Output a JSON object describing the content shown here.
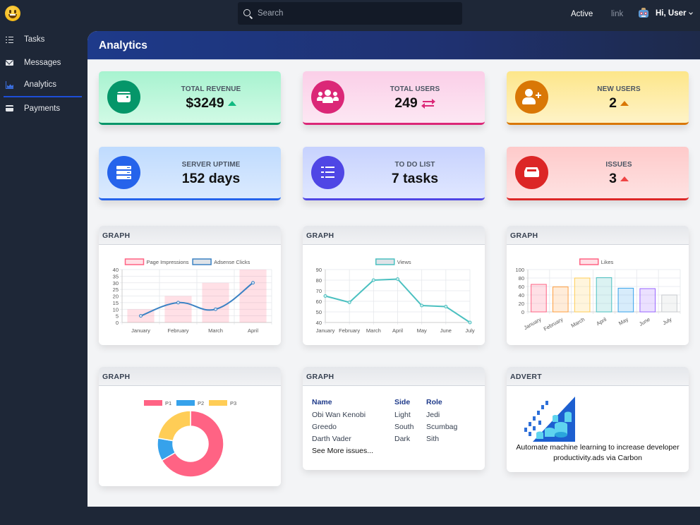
{
  "topbar": {
    "search_placeholder": "Search",
    "nav_active": "Active",
    "nav_link": "link",
    "user_greeting": "Hi, User"
  },
  "sidebar": {
    "items": [
      {
        "label": "Tasks",
        "icon": "tasks-icon",
        "active": false
      },
      {
        "label": "Messages",
        "icon": "envelope-icon",
        "active": false
      },
      {
        "label": "Analytics",
        "icon": "chart-area-icon",
        "active": true
      },
      {
        "label": "Payments",
        "icon": "credit-card-icon",
        "active": false
      }
    ]
  },
  "page": {
    "title": "Analytics"
  },
  "stats": [
    {
      "title": "TOTAL REVENUE",
      "value": "$3249",
      "trend": "up",
      "icon": "wallet-icon",
      "color": "#059669",
      "bg_from": "#a7f3d0",
      "bg_to": "#d1fae5"
    },
    {
      "title": "TOTAL USERS",
      "value": "249",
      "trend": "exchange",
      "icon": "users-icon",
      "color": "#db2777",
      "bg_from": "#fbcfe8",
      "bg_to": "#fce7f3"
    },
    {
      "title": "NEW USERS",
      "value": "2",
      "trend": "up",
      "icon": "user-plus-icon",
      "color": "#d97706",
      "bg_from": "#fde68a",
      "bg_to": "#fef3c7"
    },
    {
      "title": "SERVER UPTIME",
      "value": "152 days",
      "trend": "none",
      "icon": "server-icon",
      "color": "#2563eb",
      "bg_from": "#bfdbfe",
      "bg_to": "#dbeafe"
    },
    {
      "title": "TO DO LIST",
      "value": "7 tasks",
      "trend": "none",
      "icon": "tasks-icon",
      "color": "#4f46e5",
      "bg_from": "#c7d2fe",
      "bg_to": "#e0e7ff"
    },
    {
      "title": "ISSUES",
      "value": "3",
      "trend": "up",
      "icon": "inbox-icon",
      "color": "#dc2626",
      "bg_from": "#fecaca",
      "bg_to": "#fee2e2"
    }
  ],
  "panels": {
    "graph_label": "GRAPH",
    "advert_label": "ADVERT"
  },
  "chart_data": [
    {
      "type": "bar",
      "title": "",
      "categories": [
        "January",
        "February",
        "March",
        "April"
      ],
      "series": [
        {
          "name": "Page Impressions",
          "kind": "bar",
          "values": [
            10,
            20,
            30,
            40
          ],
          "color": "#ff6384"
        },
        {
          "name": "Adsense Clicks",
          "kind": "line",
          "values": [
            5,
            15,
            10,
            30
          ],
          "color": "#3b82c4"
        }
      ],
      "yticks": [
        0,
        5,
        10,
        15,
        20,
        25,
        30,
        35,
        40
      ],
      "ylim": [
        0,
        40
      ],
      "grid": true,
      "legend": "top"
    },
    {
      "type": "line",
      "title": "",
      "categories": [
        "January",
        "February",
        "March",
        "April",
        "May",
        "June",
        "July"
      ],
      "series": [
        {
          "name": "Views",
          "values": [
            65,
            59,
            80,
            81,
            56,
            55,
            40
          ],
          "color": "#4bc0c0"
        }
      ],
      "yticks": [
        40,
        50,
        60,
        70,
        80,
        90
      ],
      "ylim": [
        40,
        90
      ],
      "grid": true,
      "legend": "top"
    },
    {
      "type": "bar",
      "title": "",
      "categories": [
        "January",
        "February",
        "March",
        "April",
        "May",
        "June",
        "July"
      ],
      "series": [
        {
          "name": "Likes",
          "values": [
            65,
            59,
            80,
            81,
            56,
            55,
            40
          ],
          "colors": [
            "#ff6384",
            "#ff9f40",
            "#ffcd56",
            "#4bc0c0",
            "#36a2eb",
            "#9966ff",
            "#c9cbcf"
          ]
        }
      ],
      "yticks": [
        0,
        20,
        40,
        60,
        80,
        100
      ],
      "ylim": [
        0,
        100
      ],
      "grid": true,
      "legend": "top"
    },
    {
      "type": "pie",
      "subtype": "doughnut",
      "labels": [
        "P1",
        "P2",
        "P3"
      ],
      "values": [
        300,
        50,
        100
      ],
      "colors": [
        "#ff6384",
        "#36a2eb",
        "#ffcd56"
      ],
      "legend": "top"
    }
  ],
  "people": {
    "headers": [
      "Name",
      "Side",
      "Role"
    ],
    "rows": [
      [
        "Obi Wan Kenobi",
        "Light",
        "Jedi"
      ],
      [
        "Greedo",
        "South",
        "Scumbag"
      ],
      [
        "Darth Vader",
        "Dark",
        "Sith"
      ]
    ],
    "more_link": "See More issues..."
  },
  "advert": {
    "text": "Automate machine learning to increase developer productivity.ads via Carbon"
  }
}
